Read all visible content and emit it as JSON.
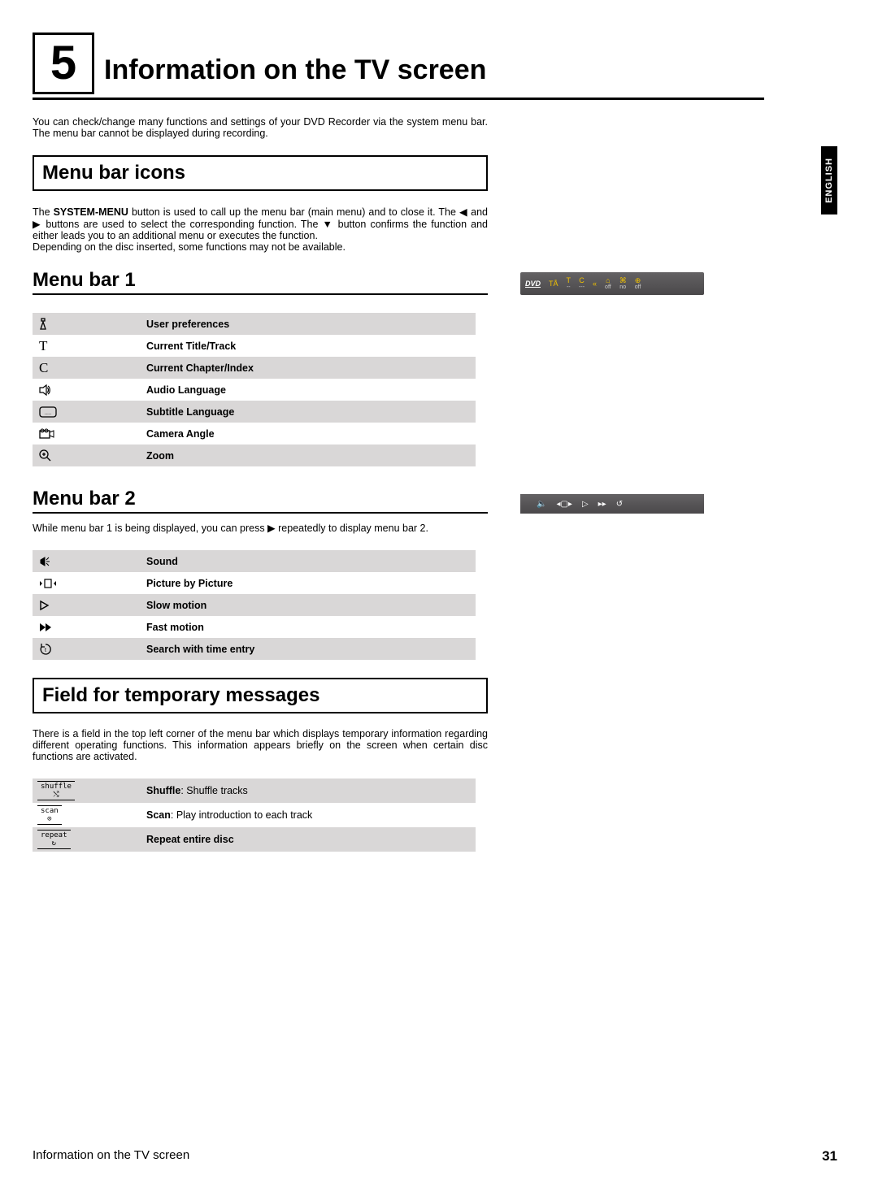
{
  "chapter": {
    "number": "5",
    "title": "Information on the TV screen"
  },
  "side_tab": "ENGLISH",
  "intro": "You can check/change many functions and settings of your DVD Recorder via the system menu bar. The menu bar cannot be displayed during recording.",
  "section1": {
    "heading": "Menu bar icons",
    "p_part1": "The ",
    "p_system_menu": "SYSTEM-MENU",
    "p_part2": " button is used to call up the menu bar (main menu) and to close it. The ",
    "p_part3": " and ",
    "p_part4": " buttons are used to select the corresponding function. The ",
    "p_part5": " button confirms the function and either leads you to an additional menu or executes the function.",
    "p_line2": "Depending on the disc inserted, some functions may not be available."
  },
  "menu1": {
    "heading": "Menu bar 1",
    "osd": {
      "dvd": "DVD",
      "cells": [
        {
          "top": "TÅ",
          "bot": ""
        },
        {
          "top": "T",
          "bot": "--"
        },
        {
          "top": "C",
          "bot": "---"
        },
        {
          "top": "«",
          "bot": ""
        },
        {
          "top": "⌂",
          "bot": "off"
        },
        {
          "top": "⌘",
          "bot": "no"
        },
        {
          "top": "⊕",
          "bot": "off"
        }
      ]
    },
    "items": [
      {
        "icon": "prefs",
        "label": "User preferences"
      },
      {
        "icon": "T",
        "label": "Current Title/Track"
      },
      {
        "icon": "C",
        "label": "Current Chapter/Index"
      },
      {
        "icon": "audio",
        "label": "Audio Language"
      },
      {
        "icon": "subtitle",
        "label": "Subtitle Language"
      },
      {
        "icon": "camera",
        "label": "Camera Angle"
      },
      {
        "icon": "zoom",
        "label": "Zoom"
      }
    ]
  },
  "menu2": {
    "heading": "Menu bar 2",
    "p_part1": "While menu bar 1 is being displayed, you can press ",
    "p_part2": " repeatedly to display menu bar 2.",
    "items": [
      {
        "icon": "sound",
        "label": "Sound"
      },
      {
        "icon": "pbp",
        "label": "Picture by Picture"
      },
      {
        "icon": "slow",
        "label": "Slow motion"
      },
      {
        "icon": "fast",
        "label": "Fast motion"
      },
      {
        "icon": "search",
        "label": "Search with time entry"
      }
    ]
  },
  "section_msgs": {
    "heading": "Field for temporary messages",
    "p": "There is a field in the top left corner of the menu bar which displays temporary information regarding different operating functions. This information appears briefly on the screen when certain disc functions are activated.",
    "items": [
      {
        "icon": "shuffle",
        "label_bold": "Shuffle",
        "label_rest": ": Shuffle tracks"
      },
      {
        "icon": "scan",
        "label_bold": "Scan",
        "label_rest": ": Play introduction to each track"
      },
      {
        "icon": "repeat",
        "label_bold": "Repeat entire disc",
        "label_rest": ""
      }
    ]
  },
  "footer": {
    "title": "Information on the TV screen",
    "page": "31"
  }
}
